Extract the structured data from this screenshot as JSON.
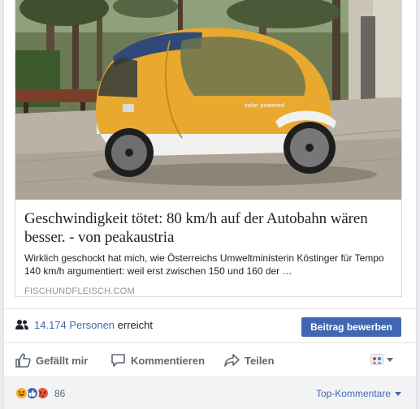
{
  "link_preview": {
    "title": "Geschwindigkeit tötet: 80 km/h auf der Autobahn wären besser. - von peakaustria",
    "description": "Wirklich geschockt hat mich, wie Österreichs Umweltministerin Köstinger für Tempo 140 km/h argumentiert: weil erst zwischen 150 und 160 der …",
    "domain": "FISCHUNDFLEISCH.COM",
    "vehicle_decal": "solar powered"
  },
  "reach": {
    "count": "14.174 Personen",
    "suffix": "erreicht",
    "boost_label": "Beitrag bewerben"
  },
  "actions": {
    "like": "Gefällt mir",
    "comment": "Kommentieren",
    "share": "Teilen"
  },
  "summary": {
    "reaction_count": "86",
    "sort_label": "Top-Kommentare",
    "reactions": [
      "haha-icon",
      "like-icon",
      "angry-icon"
    ]
  },
  "colors": {
    "brand": "#4267b2",
    "action_text": "#606770",
    "vehicle_yellow": "#e9a92f"
  }
}
